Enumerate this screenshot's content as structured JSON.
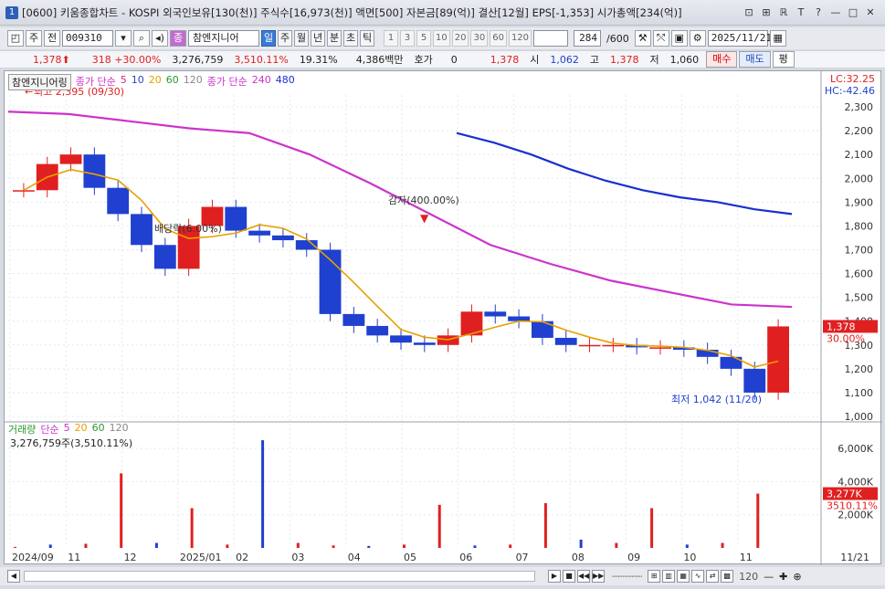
{
  "window": {
    "badge": "1",
    "title": "[0600] 키움종합차트 - KOSPI 외국인보유[130(천)] 주식수[16,973(천)] 액면[500] 자본금[89(억)] 결산[12월] EPS[-1,353] 시가총액[234(억)]",
    "buttons": [
      "⊡",
      "⊞",
      "ℝ",
      "T",
      "?",
      "—",
      "□",
      "✕"
    ]
  },
  "toolbar": {
    "period_type": "주",
    "scope": "전",
    "code": "009310",
    "stock_name": "참엔지니어",
    "tabs": [
      "일",
      "주",
      "월",
      "년",
      "분",
      "초",
      "틱"
    ],
    "active_tab": "일",
    "intervals": [
      "1",
      "3",
      "5",
      "10",
      "20",
      "30",
      "60",
      "120"
    ],
    "count": "284",
    "max": "/600",
    "date": "2025/11/21"
  },
  "quote": {
    "price": "1,378",
    "arrow": "⬆",
    "change": "318",
    "change_pct": "+30.00%",
    "volume": "3,276,759",
    "volume_ratio": "3,510.11%",
    "turnover": "19.31%",
    "amount": "4,386백만",
    "hoga_label": "호가",
    "hoga_value": "0",
    "current": "1,378",
    "open_label": "시",
    "open": "1,062",
    "high_label": "고",
    "high": "1,378",
    "low_label": "저",
    "low": "1,060",
    "buy_label": "매수",
    "sell_label": "매도",
    "extra_label": "평"
  },
  "legend": {
    "stock": "참엔지니어링",
    "ma_label": "종가 단순",
    "ma_periods": [
      "5",
      "10",
      "20",
      "60",
      "120"
    ],
    "ma2_label": "종가 단순",
    "ma2_periods": [
      "240",
      "480"
    ],
    "lc": "LC:32.25",
    "hc": "HC:-42.46"
  },
  "annotations": {
    "high": "최고 2,395 (09/30)",
    "low": "최저 1,042 (11/20)",
    "dividend": "배당락(6.00%)",
    "reduction": "감자(400.00%)"
  },
  "price_axis": [
    "2,300",
    "2,200",
    "2,100",
    "2,000",
    "1,900",
    "1,800",
    "1,700",
    "1,600",
    "1,500",
    "1,400",
    "1,300",
    "1,200",
    "1,100",
    "1,000"
  ],
  "price_tag": {
    "value": "1,378",
    "pct": "30.00%"
  },
  "volume_legend": {
    "label": "거래량",
    "ma_label": "단순",
    "periods": [
      "5",
      "20",
      "60",
      "120"
    ],
    "current": "3,276,759주(3,510.11%)"
  },
  "volume_axis": [
    "6,000K",
    "4,000K",
    "2,000K"
  ],
  "volume_tag": {
    "value": "3,277K",
    "pct": "3510.11%"
  },
  "x_axis": [
    "2024/09",
    "11",
    "12",
    "2025/01",
    "02",
    "03",
    "04",
    "05",
    "06",
    "07",
    "08",
    "09",
    "10",
    "11",
    "11/21"
  ],
  "colors": {
    "up": "#e02020",
    "down": "#2040d0",
    "ma240": "#cc33cc",
    "ma480": "#1a2fd0",
    "ma5": "#cc2a8a",
    "ma10": "#3040c0",
    "ma20": "#e8a000",
    "ma60": "#2a9a2a",
    "ma120": "#888888"
  },
  "chart_data": {
    "type": "candlestick",
    "ylim": [
      1000,
      2350
    ],
    "series_ma480": {
      "name": "480",
      "values": [
        2190,
        2150,
        2100,
        2040,
        1990,
        1950,
        1920,
        1900,
        1870,
        1850
      ]
    },
    "series_ma240": {
      "name": "240",
      "values": [
        2280,
        2270,
        2240,
        2210,
        2190,
        2100,
        1980,
        1850,
        1720,
        1640,
        1570,
        1520,
        1470,
        1460
      ]
    },
    "closes": [
      1950,
      2060,
      2100,
      1960,
      1850,
      1720,
      1620,
      1800,
      1880,
      1780,
      1760,
      1740,
      1700,
      1430,
      1380,
      1340,
      1310,
      1300,
      1340,
      1440,
      1420,
      1400,
      1330,
      1300,
      1300,
      1300,
      1290,
      1290,
      1280,
      1250,
      1200,
      1100,
      1378
    ],
    "volumes_k": [
      60,
      200,
      250,
      4500,
      300,
      2400,
      200,
      6500,
      300,
      150,
      120,
      200,
      2600,
      150,
      200,
      2700,
      500,
      300,
      2400,
      200,
      300,
      3277
    ]
  }
}
